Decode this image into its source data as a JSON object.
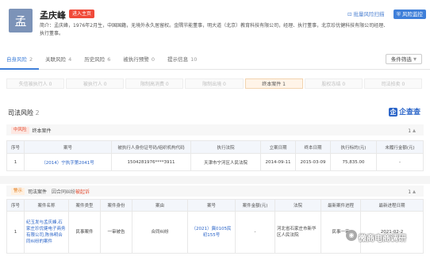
{
  "header": {
    "avatar_char": "孟",
    "name": "孟庆峰",
    "badge": "进入主页",
    "bio": "简介：孟庆峰，1976年2月生，中国国籍，无境外永久居留权。金隅节能董事，明大道（北京）教育科技有限公司，经理、执行董事，北京珍优健科技有限公司经理、执行董事。",
    "btn_risk": "批量风险扫描",
    "btn_monitor": "风险监控"
  },
  "tabs": [
    {
      "label": "自身风险",
      "count": "2"
    },
    {
      "label": "关联风险",
      "count": "4"
    },
    {
      "label": "历史风险",
      "count": "6"
    },
    {
      "label": "被执行预警",
      "count": "0"
    },
    {
      "label": "提示信息",
      "count": "10"
    }
  ],
  "filter_label": "条件筛选",
  "subtabs": [
    "失信被执行人 0",
    "被执行人 0",
    "限制高消费 0",
    "限制出境 0",
    "终本案件 1",
    "股权冻结 0",
    "司法拍卖 0"
  ],
  "section": {
    "title": "司法风险",
    "count": "2",
    "logo_text": "企查查",
    "logo_char": "企"
  },
  "group1": {
    "tag": "中风险",
    "title": "终本案件",
    "count": "1",
    "headers": [
      "序号",
      "案号",
      "被执行人身份证号码/组织机构代码",
      "执行法院",
      "立案日期",
      "终本日期",
      "执行标的(元)",
      "未履行金额(元)"
    ],
    "rows": [
      [
        "1",
        "（2014）宁执字第2041号",
        "1504281976****3911",
        "天津市宁河区人民法院",
        "2014-09-11",
        "2015-03-09",
        "75,835.00",
        "-"
      ]
    ]
  },
  "group2": {
    "tag": "警示",
    "title": "司法案件",
    "mid_prefix": "因合同纠纷",
    "mid_highlight": "被起诉",
    "count": "1",
    "headers": [
      "序号",
      "案件名称",
      "案件类型",
      "案件身份",
      "案由",
      "案号",
      "案件金额(元)",
      "法院",
      "最新案件进程",
      "最新进程日期"
    ],
    "rows": [
      [
        "1",
        "纪玉发与孟庆峰,石家庄珍优健电子商务有限公司,陈伟明合同纠纷的案件",
        "民事案件",
        "一审被告",
        "合同纠纷",
        "（2021）冀0105民初155号",
        "-",
        "河北省石家庄市新华区人民法院",
        "民事一审",
        "2021-02-2"
      ]
    ]
  },
  "watermark": "微商电商调研"
}
